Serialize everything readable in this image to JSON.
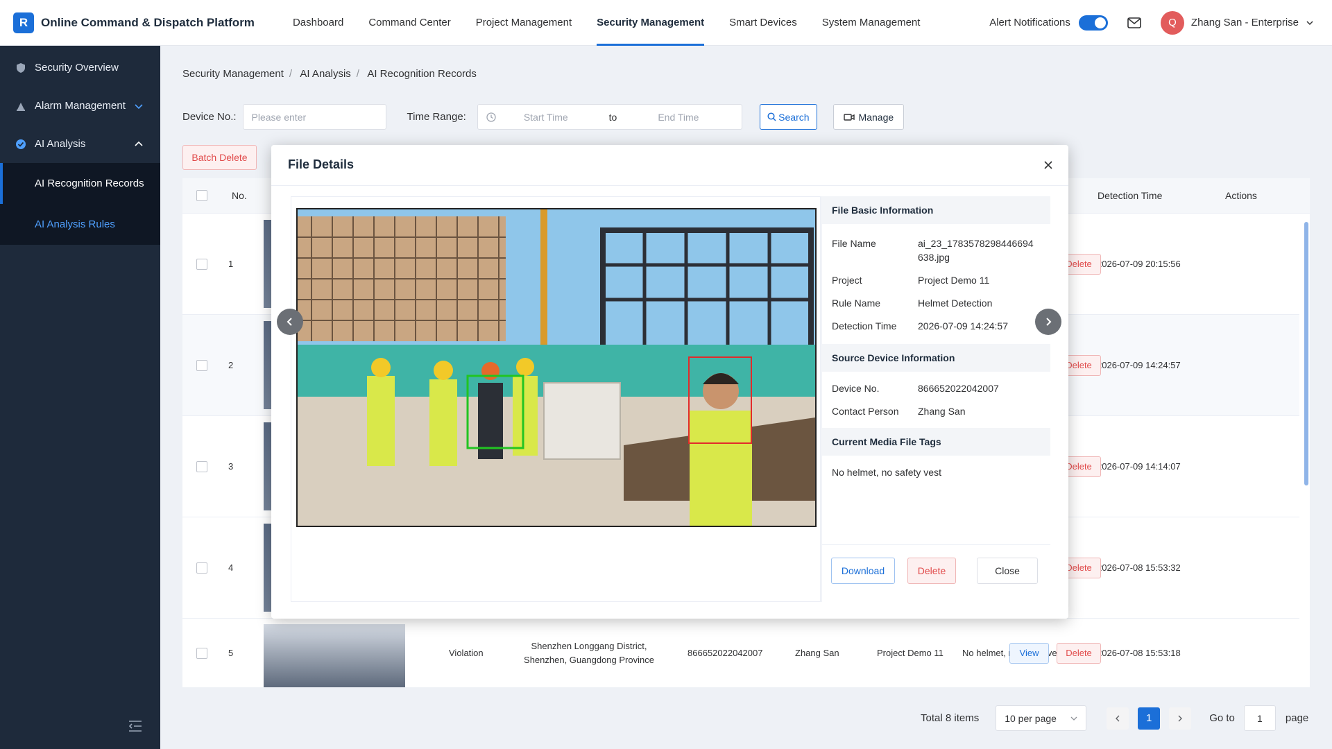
{
  "app": {
    "logo_letter": "R",
    "title": "Online Command & Dispatch Platform"
  },
  "nav": [
    "Dashboard",
    "Command Center",
    "Project Management",
    "Security Management",
    "Smart Devices",
    "System Management"
  ],
  "header": {
    "alert_label": "Alert Notifications",
    "alert_on": true,
    "avatar_letter": "Q",
    "user": "Zhang San - Enterprise"
  },
  "sidebar": {
    "items": [
      "Security Overview",
      "Alarm Management",
      "AI Analysis"
    ],
    "subitems": [
      "AI Recognition Records",
      "AI Analysis Rules"
    ]
  },
  "breadcrumb": [
    "Security Management",
    "AI Analysis",
    "AI Recognition Records"
  ],
  "filter": {
    "device_label": "Device No.:",
    "device_placeholder": "Please enter",
    "time_label": "Time Range:",
    "start_placeholder": "Start Time",
    "to": "to",
    "end_placeholder": "End Time",
    "search": "Search",
    "manage": "Manage"
  },
  "batch_delete": "Batch Delete",
  "table": {
    "headers": {
      "no": "No.",
      "detection_time": "Detection Time",
      "actions": "Actions"
    },
    "view": "View",
    "delete": "Delete",
    "rows": [
      {
        "no": "1",
        "time": "2026-07-09 20:15:56"
      },
      {
        "no": "2",
        "time": "2026-07-09 14:24:57"
      },
      {
        "no": "3",
        "time": "2026-07-09 14:14:07"
      },
      {
        "no": "4",
        "time": "2026-07-08 15:53:32"
      },
      {
        "no": "5",
        "type": "Violation",
        "location": "Shenzhen Longgang District, Shenzhen, Guangdong Province",
        "device": "866652022042007",
        "contact": "Zhang San",
        "project": "Project Demo 11",
        "tags": "No helmet, no safety vest...",
        "time": "2026-07-08 15:53:18"
      }
    ]
  },
  "pagination": {
    "total": "Total 8 items",
    "per_page": "10 per page",
    "current": "1",
    "goto": "Go to",
    "goto_value": "1",
    "page": "page"
  },
  "modal": {
    "title": "File Details",
    "basic_title": "File Basic Information",
    "basic": [
      {
        "k": "File Name",
        "v": "ai_23_1783578298446694638.jpg"
      },
      {
        "k": "Project",
        "v": "Project Demo 11"
      },
      {
        "k": "Rule Name",
        "v": "Helmet Detection"
      },
      {
        "k": "Detection Time",
        "v": "2026-07-09 14:24:57"
      }
    ],
    "source_title": "Source Device Information",
    "source": [
      {
        "k": "Device No.",
        "v": "866652022042007"
      },
      {
        "k": "Contact Person",
        "v": "Zhang San"
      }
    ],
    "tags_title": "Current Media File Tags",
    "tags": "No helmet, no safety vest",
    "download": "Download",
    "delete": "Delete",
    "close": "Close"
  },
  "colors": {
    "primary": "#1b6fd8",
    "danger": "#e14b4b",
    "sidebar": "#1e2a3b"
  }
}
